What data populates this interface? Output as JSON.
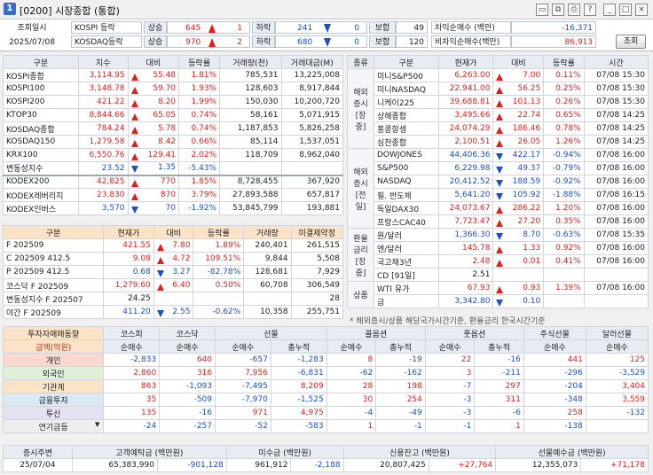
{
  "window": {
    "num": "1",
    "title": "[0200] 시장종합 (통합)",
    "icons": [
      "dock-icon",
      "copy-icon",
      "print-icon",
      "help-icon",
      "minimize-icon",
      "close-icon"
    ]
  },
  "info": {
    "label_date": "조회일시",
    "date": "2025/07/08",
    "kospi_label": "KOSPI 등락",
    "kosdaq_label": "KOSDAQ등락",
    "up_label": "상승",
    "down_label": "하락",
    "flat_label": "보합",
    "kospi_up": "645",
    "kospi_up_limit": "1",
    "kospi_down": "241",
    "kospi_down_limit": "0",
    "kospi_flat": "49",
    "kosdaq_up": "970",
    "kosdaq_up_limit": "2",
    "kosdaq_down": "680",
    "kosdaq_down_limit": "0",
    "kosdaq_flat": "120",
    "arb_label": "차익순매수 (백만)",
    "arb_value": "-16,371",
    "nonarb_label": "비차익순매수(백만)",
    "nonarb_value": "86,913",
    "query_button": "조회"
  },
  "idx": {
    "headers": [
      "구분",
      "지수",
      "대비",
      "등락률",
      "거래량(천)",
      "거래대금(M)"
    ],
    "rows": [
      [
        "KOSPI종합",
        "3,114.95",
        "up",
        "55.48",
        "1.81%",
        "785,531",
        "13,225,008"
      ],
      [
        "KOSPI100",
        "3,148.78",
        "up",
        "59.70",
        "1.93%",
        "128,603",
        "8,917,844"
      ],
      [
        "KOSPI200",
        "421.22",
        "up",
        "8.20",
        "1.99%",
        "150,030",
        "10,200,720"
      ],
      [
        "KTOP30",
        "8,844.66",
        "up",
        "65.05",
        "0.74%",
        "58,161",
        "5,071,915"
      ],
      [
        "KOSDAQ종합",
        "784.24",
        "up",
        "5.78",
        "0.74%",
        "1,187,853",
        "5,826,258"
      ],
      [
        "KOSDAQ150",
        "1,279.58",
        "up",
        "8.42",
        "0.66%",
        "85,114",
        "1,537,051"
      ],
      [
        "KRX100",
        "6,550.76",
        "up",
        "129.41",
        "2.02%",
        "118,709",
        "8,962,040"
      ],
      [
        "변동성지수",
        "23.52",
        "dn",
        "1.35",
        "-5.43%",
        "",
        ""
      ]
    ],
    "etf": [
      [
        "KODEX200",
        "42,825",
        "up",
        "770",
        "1.85%",
        "8,728,455",
        "367,920"
      ],
      [
        "KODEX레버리지",
        "23,830",
        "up",
        "870",
        "3.79%",
        "27,893,588",
        "657,817"
      ],
      [
        "KODEX인버스",
        "3,570",
        "dn",
        "70",
        "-1.92%",
        "53,845,799",
        "193,881"
      ]
    ]
  },
  "fut": {
    "headers": [
      "구분",
      "현재가",
      "대비",
      "등락률",
      "거래량",
      "미결제약정"
    ],
    "rows": [
      [
        "F 202509",
        "421.55",
        "up",
        "7.80",
        "1.89%",
        "240,401",
        "261,515"
      ],
      [
        "C 202509 412.5",
        "9.08",
        "up",
        "4.72",
        "109.51%",
        "9,844",
        "5,508"
      ],
      [
        "P 202509 412.5",
        "0.68",
        "dn",
        "3.27",
        "-82.78%",
        "128,681",
        "7,929"
      ],
      [
        "코스닥 F 202509",
        "1,279.60",
        "up",
        "6.40",
        "0.50%",
        "60,708",
        "306,549"
      ],
      [
        "변동성지수 F 202507",
        "24.25",
        "",
        "",
        "",
        "",
        "28"
      ],
      [
        "야간 F 202509",
        "411.20",
        "dn",
        "2.55",
        "-0.62%",
        "10,358",
        "255,751"
      ]
    ]
  },
  "ovs": {
    "headers": [
      "종류",
      "구분",
      "현재가",
      "대비",
      "등락률",
      "시간"
    ],
    "groups": [
      {
        "name": "해외\n증시\n[장중]",
        "rows": [
          [
            "미니S&P500",
            "6,263.00",
            "up",
            "7.00",
            "0.11%",
            "07/08 15:30"
          ],
          [
            "미니NASDAQ",
            "22,941.00",
            "up",
            "56.25",
            "0.25%",
            "07/08 15:30"
          ],
          [
            "니케이225",
            "39,688.81",
            "up",
            "101.13",
            "0.26%",
            "07/08 15:30"
          ],
          [
            "상해종합",
            "3,495.66",
            "up",
            "22.74",
            "0.65%",
            "07/08 14:25"
          ],
          [
            "홍콩항셍",
            "24,074.29",
            "up",
            "186.46",
            "0.78%",
            "07/08 14:25"
          ],
          [
            "심천종합",
            "2,100.51",
            "up",
            "26.05",
            "1.26%",
            "07/08 14:25"
          ]
        ]
      },
      {
        "name": "해외\n증시\n[전일]",
        "rows": [
          [
            "DOWJONES",
            "44,406.36",
            "dn",
            "422.17",
            "-0.94%",
            "07/08 16:00"
          ],
          [
            "S&P500",
            "6,229.98",
            "dn",
            "49.37",
            "-0.79%",
            "07/08 16:00"
          ],
          [
            "NASDAQ",
            "20,412.52",
            "dn",
            "188.59",
            "-0.92%",
            "07/08 16:00"
          ],
          [
            "필. 반도체",
            "5,641.20",
            "dn",
            "105.92",
            "-1.88%",
            "07/08 16:15"
          ],
          [
            "독일DAX30",
            "24,073.67",
            "up",
            "286.22",
            "1.20%",
            "07/08 16:00"
          ],
          [
            "프랑스CAC40",
            "7,723.47",
            "up",
            "27.20",
            "0.35%",
            "07/08 16:00"
          ]
        ]
      },
      {
        "name": "환율\n금리\n[장중]",
        "rows": [
          [
            "원/달러",
            "1,366.30",
            "dn",
            "8.70",
            "-0.63%",
            "07/08 15:35"
          ],
          [
            "엔/달러",
            "145.78",
            "up",
            "1.33",
            "0.92%",
            "07/08 16:00"
          ],
          [
            "국고채3년",
            "2.48",
            "up",
            "0.01",
            "0.41%",
            "07/08 16:00"
          ],
          [
            "CD [91일]",
            "2.51",
            "",
            "",
            "",
            ""
          ]
        ]
      },
      {
        "name": "상품",
        "rows": [
          [
            "WTI 유가",
            "67.93",
            "up",
            "0.93",
            "1.39%",
            "07/08 16:00"
          ],
          [
            "금",
            "3,342.80",
            "dn",
            "0.10",
            "",
            ""
          ]
        ]
      }
    ],
    "note": "* 해외증시/상품 해당국가시간기준, 환율금리 한국시간기준"
  },
  "inv": {
    "title": "투자자매매동향",
    "groups": [
      "코스피",
      "코스닥",
      "선물",
      "콜옵션",
      "풋옵션",
      "주식선물",
      "달러선물"
    ],
    "sub_net": "순매수",
    "sub_cum": "총누적",
    "amount_label": "금액(억원)",
    "rows": [
      [
        "개인",
        "-2,833",
        "640",
        "-657",
        "-1,283",
        "8",
        "-19",
        "22",
        "-16",
        "441",
        "125"
      ],
      [
        "외국인",
        "2,860",
        "316",
        "7,956",
        "-6,831",
        "-62",
        "-162",
        "3",
        "-211",
        "-296",
        "-3,529"
      ],
      [
        "기관계",
        "863",
        "-1,093",
        "-7,495",
        "8,209",
        "28",
        "198",
        "-7",
        "297",
        "-204",
        "3,404"
      ],
      [
        "금융투자",
        "35",
        "-509",
        "-7,970",
        "-1,525",
        "30",
        "254",
        "-3",
        "311",
        "-348",
        "3,559"
      ],
      [
        "투신",
        "135",
        "-16",
        "971",
        "4,975",
        "-4",
        "-49",
        "-3",
        "-6",
        "258",
        "-132"
      ],
      [
        "연기금등",
        "-24",
        "-257",
        "-52",
        "-583",
        "1",
        "-1",
        "-1",
        "1",
        "-138",
        ""
      ]
    ]
  },
  "bottom": {
    "date_label": "증시주변",
    "date": "25/07/04",
    "deposit_label": "고객예탁금 (백만원)",
    "deposit": "65,383,990",
    "deposit_chg": "-901,128",
    "unpaid_label": "미수금 (백만원)",
    "unpaid": "961,912",
    "unpaid_chg": "-2,188",
    "credit_label": "신용잔고 (백만원)",
    "credit": "20,807,425",
    "credit_chg": "+27,764",
    "futdep_label": "선물예수금 (백만원)",
    "futdep": "12,355,073",
    "futdep_chg": "+71,178"
  }
}
